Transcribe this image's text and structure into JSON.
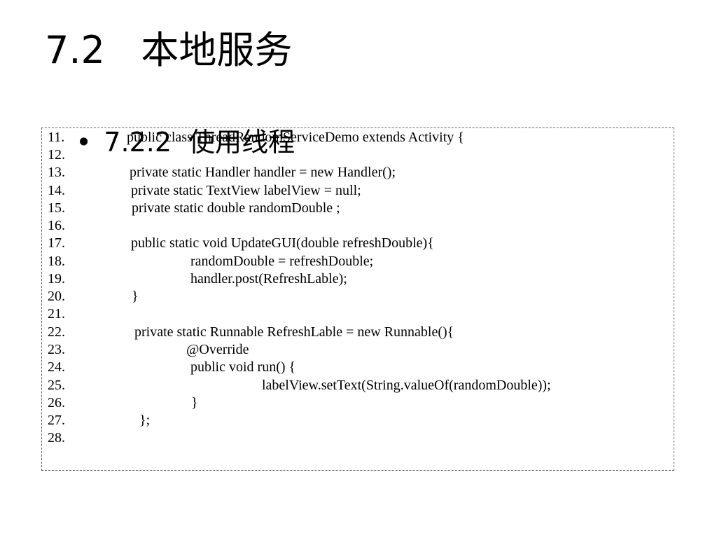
{
  "slide": {
    "title": "7.2   本地服务",
    "bullet_symbol": "•",
    "bullet_text": "7.2.2  使用线程"
  },
  "code_lines": [
    {
      "num": "11.",
      "text": "public class ThreadRandomServiceDemo extends Activity {"
    },
    {
      "num": "12.",
      "text": ""
    },
    {
      "num": "13.",
      "text": "private static Handler handler = new Handler();"
    },
    {
      "num": "14.",
      "text": "private static TextView labelView = null;"
    },
    {
      "num": "15.",
      "text": "private static double randomDouble ;"
    },
    {
      "num": "16.",
      "text": ""
    },
    {
      "num": "17.",
      "text": "public static void UpdateGUI(double refreshDouble){"
    },
    {
      "num": "18.",
      "text": "randomDouble = refreshDouble;"
    },
    {
      "num": "19.",
      "text": "handler.post(RefreshLable);"
    },
    {
      "num": "20.",
      "text": "}"
    },
    {
      "num": "21.",
      "text": ""
    },
    {
      "num": "22.",
      "text": "private static Runnable RefreshLable = new Runnable(){"
    },
    {
      "num": "23.",
      "text": "@Override"
    },
    {
      "num": "24.",
      "text": "public void run() {"
    },
    {
      "num": "25.",
      "text": "labelView.setText(String.valueOf(randomDouble));"
    },
    {
      "num": "26.",
      "text": "}"
    },
    {
      "num": "27.",
      "text": "};"
    },
    {
      "num": "28.",
      "text": ""
    }
  ]
}
